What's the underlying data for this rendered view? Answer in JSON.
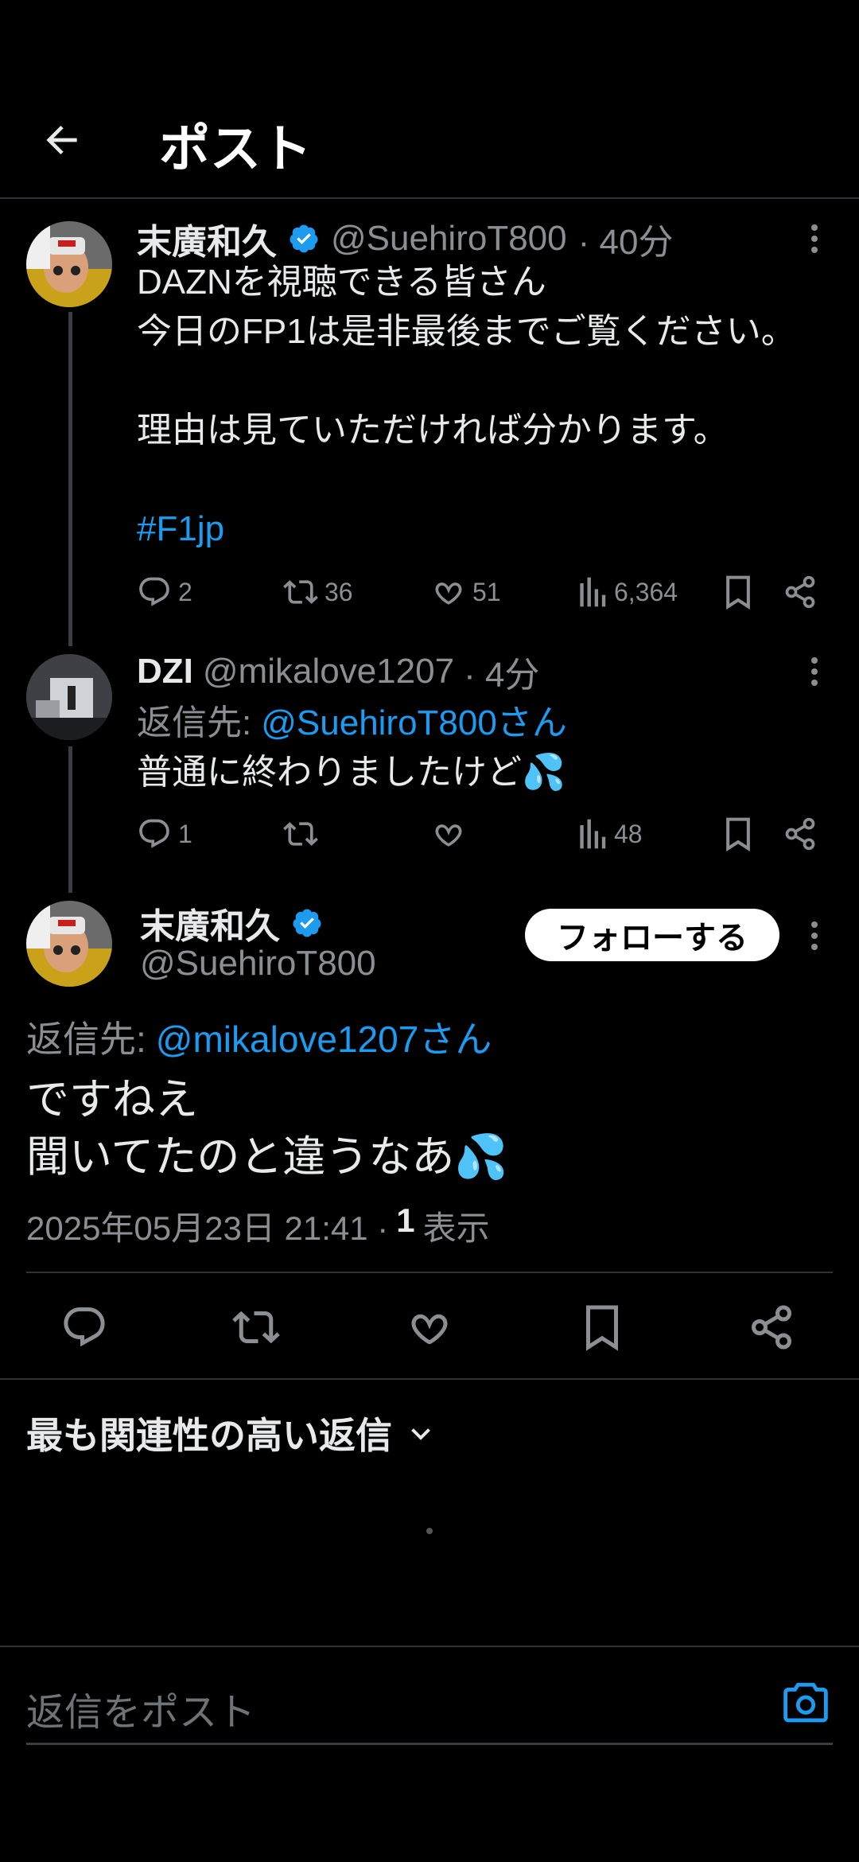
{
  "header": {
    "title": "ポスト"
  },
  "tweet1": {
    "name": "末廣和久",
    "handle": "@SuehiroT800",
    "time": "· 40分",
    "line1": "DAZNを視聴できる皆さん",
    "line2": "今日のFP1は是非最後までご覧ください。",
    "line3": "理由は見ていただければ分かります。",
    "hashtag": "#F1jp",
    "replies": "2",
    "reposts": "36",
    "likes": "51",
    "views": "6,364"
  },
  "tweet2": {
    "name": "DZI",
    "handle": "@mikalove1207",
    "time": "· 4分",
    "reply_prefix": "返信先:",
    "reply_to": "@SuehiroT800さん",
    "text": "普通に終わりましたけど💦",
    "replies": "1",
    "views": "48"
  },
  "main": {
    "name": "末廣和久",
    "handle": "@SuehiroT800",
    "follow": "フォローする",
    "reply_prefix": "返信先:",
    "reply_to": "@mikalove1207さん",
    "line1": "ですねえ",
    "line2": "聞いてたのと違うなあ💦",
    "timestamp": "2025年05月23日 21:41 ·",
    "view_count": "1",
    "view_label": "表示"
  },
  "replies_section": {
    "sort_label": "最も関連性の高い返信"
  },
  "composer": {
    "placeholder": "返信をポスト"
  },
  "colors": {
    "accent": "#1d9bf0",
    "background": "#000000"
  }
}
